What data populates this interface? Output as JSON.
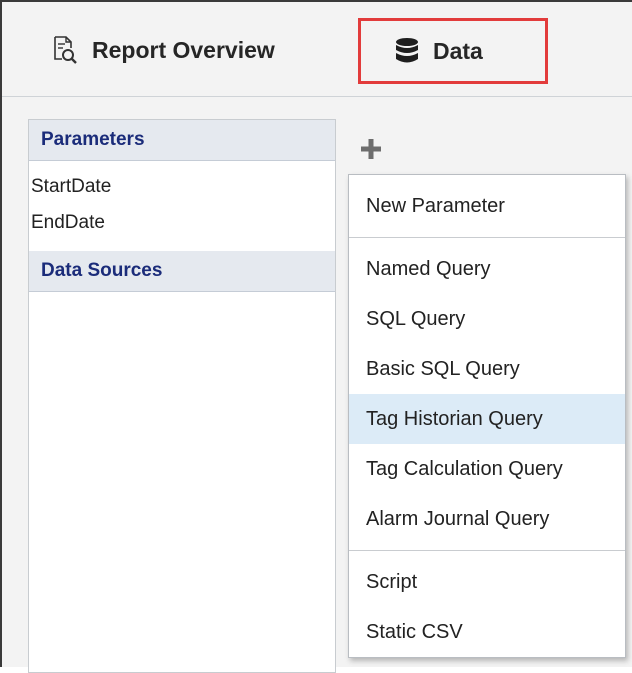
{
  "tabs": [
    {
      "label": "Report Overview",
      "icon": "report-search-icon",
      "highlighted": false
    },
    {
      "label": "Data",
      "icon": "database-icon",
      "highlighted": true,
      "highlight_color": "#e23b3b"
    }
  ],
  "panel": {
    "parameters_header": "Parameters",
    "parameters": [
      "StartDate",
      "EndDate"
    ],
    "data_sources_header": "Data Sources"
  },
  "add_button": {
    "icon": "plus-icon"
  },
  "menu": {
    "groups": [
      [
        "New Parameter"
      ],
      [
        "Named Query",
        "SQL Query",
        "Basic SQL Query",
        "Tag Historian Query",
        "Tag Calculation Query",
        "Alarm Journal Query"
      ],
      [
        "Script",
        "Static CSV"
      ]
    ],
    "highlighted_item": "Tag Historian Query",
    "highlight_color": "#dcebf7"
  },
  "colors": {
    "header_text": "#1b2c7a",
    "header_bg": "#e5e9ef"
  }
}
